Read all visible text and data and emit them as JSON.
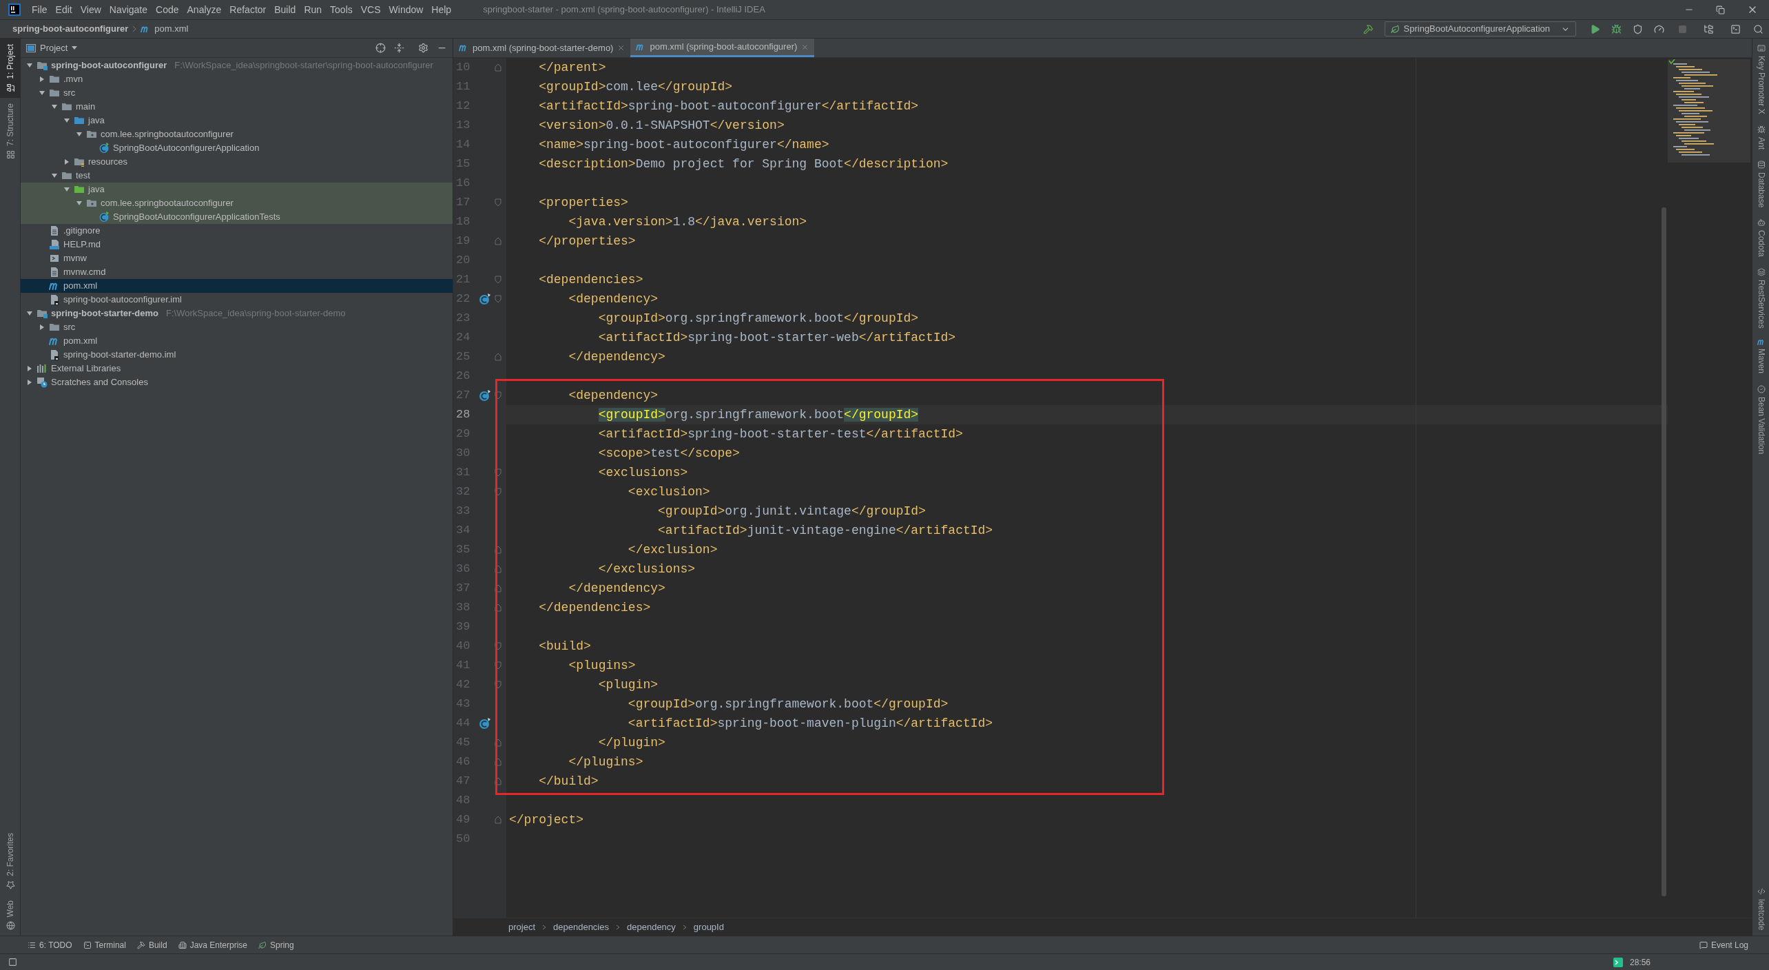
{
  "window": {
    "title": "springboot-starter - pom.xml (spring-boot-autoconfigurer) - IntelliJ IDEA"
  },
  "menu": [
    "File",
    "Edit",
    "View",
    "Navigate",
    "Code",
    "Analyze",
    "Refactor",
    "Build",
    "Run",
    "Tools",
    "VCS",
    "Window",
    "Help"
  ],
  "nav_bar": {
    "module": "spring-boot-autoconfigurer",
    "file": "pom.xml"
  },
  "run_config": "SpringBootAutoconfigurerApplication",
  "left_strip": {
    "top": [
      {
        "label": "1: Project",
        "kind": "project",
        "selected": true
      },
      {
        "label": "7: Structure",
        "kind": "structure",
        "selected": false
      }
    ],
    "bottom": [
      {
        "label": "2: Favorites",
        "kind": "favorites",
        "selected": false
      },
      {
        "label": "Web",
        "kind": "web",
        "selected": false
      }
    ]
  },
  "project_panel": {
    "title": "Project",
    "tree": [
      {
        "name": "spring-boot-autoconfigurer",
        "path": "F:\\WorkSpace_idea\\springboot-starter\\spring-boot-autoconfigurer",
        "kind": "module",
        "expanded": true,
        "selected": false,
        "test": false,
        "children": [
          {
            "name": ".mvn",
            "kind": "folder",
            "expanded": false,
            "selected": false,
            "test": false
          },
          {
            "name": "src",
            "kind": "folder",
            "expanded": true,
            "selected": false,
            "test": false,
            "children": [
              {
                "name": "main",
                "kind": "folder",
                "expanded": true,
                "selected": false,
                "test": false,
                "children": [
                  {
                    "name": "java",
                    "kind": "source",
                    "expanded": true,
                    "selected": false,
                    "test": false,
                    "children": [
                      {
                        "name": "com.lee.springbootautoconfigurer",
                        "kind": "package",
                        "expanded": true,
                        "selected": false,
                        "test": false,
                        "children": [
                          {
                            "name": "SpringBootAutoconfigurerApplication",
                            "kind": "spring-class",
                            "selected": false,
                            "test": false
                          }
                        ]
                      }
                    ]
                  },
                  {
                    "name": "resources",
                    "kind": "resources",
                    "expanded": false,
                    "selected": false,
                    "test": false
                  }
                ]
              },
              {
                "name": "test",
                "kind": "folder",
                "expanded": true,
                "selected": false,
                "test": false,
                "children": [
                  {
                    "name": "java",
                    "kind": "test-source",
                    "expanded": true,
                    "selected": false,
                    "test": true,
                    "children": [
                      {
                        "name": "com.lee.springbootautoconfigurer",
                        "kind": "package",
                        "expanded": true,
                        "selected": false,
                        "test": true,
                        "children": [
                          {
                            "name": "SpringBootAutoconfigurerApplicationTests",
                            "kind": "spring-class",
                            "selected": false,
                            "test": true
                          }
                        ]
                      }
                    ]
                  }
                ]
              }
            ]
          },
          {
            "name": ".gitignore",
            "kind": "file",
            "selected": false,
            "test": false
          },
          {
            "name": "HELP.md",
            "kind": "markdown",
            "selected": false,
            "test": false
          },
          {
            "name": "mvnw",
            "kind": "script",
            "selected": false,
            "test": false
          },
          {
            "name": "mvnw.cmd",
            "kind": "file",
            "selected": false,
            "test": false
          },
          {
            "name": "pom.xml",
            "kind": "maven",
            "selected": true,
            "test": false
          },
          {
            "name": "spring-boot-autoconfigurer.iml",
            "kind": "iml",
            "selected": false,
            "test": false
          }
        ]
      },
      {
        "name": "spring-boot-starter-demo",
        "path": "F:\\WorkSpace_idea\\spring-boot-starter-demo",
        "kind": "module",
        "expanded": true,
        "selected": false,
        "test": false,
        "children": [
          {
            "name": "src",
            "kind": "folder",
            "expanded": false,
            "selected": false,
            "test": false
          },
          {
            "name": "pom.xml",
            "kind": "maven",
            "selected": false,
            "test": false
          },
          {
            "name": "spring-boot-starter-demo.iml",
            "kind": "iml",
            "selected": false,
            "test": false
          }
        ]
      },
      {
        "name": "External Libraries",
        "kind": "libraries",
        "expanded": false,
        "selected": false,
        "test": false
      },
      {
        "name": "Scratches and Consoles",
        "kind": "scratches",
        "expanded": false,
        "selected": false,
        "test": false
      }
    ]
  },
  "editor_tabs": [
    {
      "label": "pom.xml (spring-boot-starter-demo)",
      "selected": false
    },
    {
      "label": "pom.xml (spring-boot-autoconfigurer)",
      "selected": true
    }
  ],
  "code_lines": [
    {
      "number": "10",
      "text": "    </parent>",
      "fold_close": true,
      "current": false
    },
    {
      "number": "11",
      "text": "    <groupId>com.lee</groupId>",
      "current": false
    },
    {
      "number": "12",
      "text": "    <artifactId>spring-boot-autoconfigurer</artifactId>",
      "current": false
    },
    {
      "number": "13",
      "text": "    <version>0.0.1-SNAPSHOT</version>",
      "current": false
    },
    {
      "number": "14",
      "text": "    <name>spring-boot-autoconfigurer</name>",
      "current": false
    },
    {
      "number": "15",
      "text": "    <description>Demo project for Spring Boot</description>",
      "current": false
    },
    {
      "number": "16",
      "current": false
    },
    {
      "number": "17",
      "text": "    <properties>",
      "fold_open": true,
      "current": false
    },
    {
      "number": "18",
      "text": "        <java.version>1.8</java.version>",
      "current": false
    },
    {
      "number": "19",
      "text": "    </properties>",
      "fold_close": true,
      "current": false
    },
    {
      "number": "20",
      "current": false
    },
    {
      "number": "21",
      "text": "    <dependencies>",
      "fold_open": true,
      "current": false
    },
    {
      "number": "22",
      "text": "        <dependency>",
      "fold_open": true,
      "bean_marker": true,
      "current": false
    },
    {
      "number": "23",
      "text": "            <groupId>org.springframework.boot</groupId>",
      "current": false
    },
    {
      "number": "24",
      "text": "            <artifactId>spring-boot-starter-web</artifactId>",
      "current": false
    },
    {
      "number": "25",
      "text": "        </dependency>",
      "fold_close": true,
      "current": false
    },
    {
      "number": "26",
      "current": false
    },
    {
      "number": "27",
      "text": "        <dependency>",
      "fold_open": true,
      "bean_marker": true,
      "current": false
    },
    {
      "number": "28",
      "text": "            <groupId>org.springframework.boot</groupId>",
      "current": true,
      "tag_match": true
    },
    {
      "number": "29",
      "text": "            <artifactId>spring-boot-starter-test</artifactId>",
      "current": false
    },
    {
      "number": "30",
      "text": "            <scope>test</scope>",
      "current": false
    },
    {
      "number": "31",
      "text": "            <exclusions>",
      "fold_open": true,
      "current": false
    },
    {
      "number": "32",
      "text": "                <exclusion>",
      "fold_open": true,
      "current": false
    },
    {
      "number": "33",
      "text": "                    <groupId>org.junit.vintage</groupId>",
      "current": false
    },
    {
      "number": "34",
      "text": "                    <artifactId>junit-vintage-engine</artifactId>",
      "current": false
    },
    {
      "number": "35",
      "text": "                </exclusion>",
      "fold_close": true,
      "current": false
    },
    {
      "number": "36",
      "text": "            </exclusions>",
      "fold_close": true,
      "current": false
    },
    {
      "number": "37",
      "text": "        </dependency>",
      "fold_close": true,
      "current": false
    },
    {
      "number": "38",
      "text": "    </dependencies>",
      "fold_close": true,
      "current": false
    },
    {
      "number": "39",
      "current": false
    },
    {
      "number": "40",
      "text": "    <build>",
      "fold_open": true,
      "current": false
    },
    {
      "number": "41",
      "text": "        <plugins>",
      "fold_open": true,
      "current": false
    },
    {
      "number": "42",
      "text": "            <plugin>",
      "fold_open": true,
      "current": false
    },
    {
      "number": "43",
      "text": "                <groupId>org.springframework.boot</groupId>",
      "current": false
    },
    {
      "number": "44",
      "text": "                <artifactId>spring-boot-maven-plugin</artifactId>",
      "bean_marker": true,
      "current": false
    },
    {
      "number": "45",
      "text": "            </plugin>",
      "fold_close": true,
      "current": false
    },
    {
      "number": "46",
      "text": "        </plugins>",
      "fold_close": true,
      "current": false
    },
    {
      "number": "47",
      "text": "    </build>",
      "fold_close": true,
      "current": false
    },
    {
      "number": "48",
      "current": false
    },
    {
      "number": "49",
      "text": "</project>",
      "fold_close": true,
      "current": false
    },
    {
      "number": "50",
      "current": false
    }
  ],
  "breadcrumbs": [
    "project",
    "dependencies",
    "dependency",
    "groupId"
  ],
  "right_strip": {
    "top": [
      {
        "label": "Key Promoter X",
        "kind": "keyboard"
      },
      {
        "label": "Ant",
        "kind": "ant"
      },
      {
        "label": "Database",
        "kind": "database"
      },
      {
        "label": "Codota",
        "kind": "codota"
      },
      {
        "label": "RestServices",
        "kind": "rest"
      },
      {
        "label": "Maven",
        "kind": "maven"
      },
      {
        "label": "Bean Validation",
        "kind": "bean"
      }
    ],
    "bottom": [
      {
        "label": "leetcode",
        "kind": "leetcode"
      }
    ]
  },
  "tool_windows": [
    {
      "label": "6: TODO",
      "kind": "todo"
    },
    {
      "label": "Terminal",
      "kind": "terminal"
    },
    {
      "label": "Build",
      "kind": "build"
    },
    {
      "label": "Java Enterprise",
      "kind": "enterprise"
    },
    {
      "label": "Spring",
      "kind": "spring"
    }
  ],
  "event_log": "Event Log",
  "status_bar": {
    "position": "28:56"
  }
}
